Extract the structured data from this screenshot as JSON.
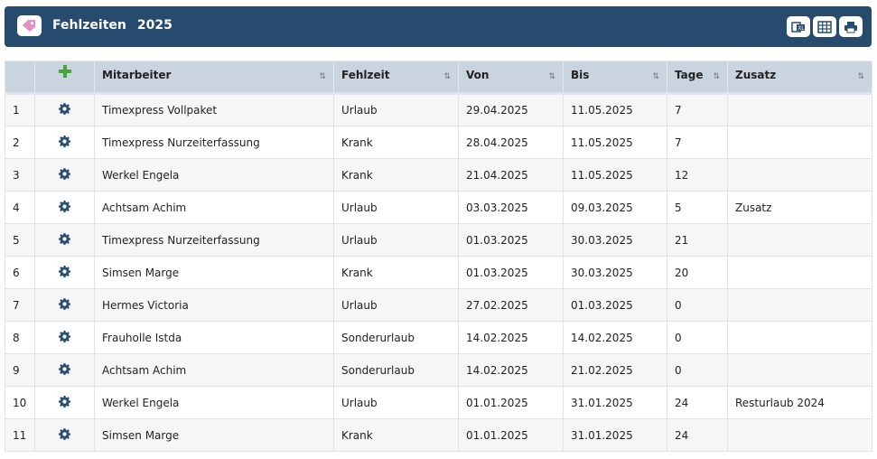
{
  "header": {
    "title": "Fehlzeiten",
    "year": "2025",
    "buttons": [
      "excel-export",
      "table-view",
      "print"
    ]
  },
  "colors": {
    "header_bg": "#274b6e",
    "plus": "#4aa33a",
    "gear": "#2c4f72",
    "tag": "#e48ec2"
  },
  "table": {
    "columns": [
      "",
      "",
      "Mitarbeiter",
      "Fehlzeit",
      "Von",
      "Bis",
      "Tage",
      "Zusatz"
    ],
    "sort_icon": "⇅",
    "rows": [
      {
        "nr": "1",
        "mitarbeiter": "Timexpress Vollpaket",
        "fehlzeit": "Urlaub",
        "von": "29.04.2025",
        "bis": "11.05.2025",
        "tage": "7",
        "zusatz": ""
      },
      {
        "nr": "2",
        "mitarbeiter": "Timexpress Nurzeiterfassung",
        "fehlzeit": "Krank",
        "von": "28.04.2025",
        "bis": "11.05.2025",
        "tage": "7",
        "zusatz": ""
      },
      {
        "nr": "3",
        "mitarbeiter": "Werkel Engela",
        "fehlzeit": "Krank",
        "von": "21.04.2025",
        "bis": "11.05.2025",
        "tage": "12",
        "zusatz": ""
      },
      {
        "nr": "4",
        "mitarbeiter": "Achtsam Achim",
        "fehlzeit": "Urlaub",
        "von": "03.03.2025",
        "bis": "09.03.2025",
        "tage": "5",
        "zusatz": "Zusatz"
      },
      {
        "nr": "5",
        "mitarbeiter": "Timexpress Nurzeiterfassung",
        "fehlzeit": "Urlaub",
        "von": "01.03.2025",
        "bis": "30.03.2025",
        "tage": "21",
        "zusatz": ""
      },
      {
        "nr": "6",
        "mitarbeiter": "Simsen Marge",
        "fehlzeit": "Krank",
        "von": "01.03.2025",
        "bis": "30.03.2025",
        "tage": "20",
        "zusatz": ""
      },
      {
        "nr": "7",
        "mitarbeiter": "Hermes Victoria",
        "fehlzeit": "Urlaub",
        "von": "27.02.2025",
        "bis": "01.03.2025",
        "tage": "0",
        "zusatz": ""
      },
      {
        "nr": "8",
        "mitarbeiter": "Frauholle Istda",
        "fehlzeit": "Sonderurlaub",
        "von": "14.02.2025",
        "bis": "14.02.2025",
        "tage": "0",
        "zusatz": ""
      },
      {
        "nr": "9",
        "mitarbeiter": "Achtsam Achim",
        "fehlzeit": "Sonderurlaub",
        "von": "14.02.2025",
        "bis": "21.02.2025",
        "tage": "0",
        "zusatz": ""
      },
      {
        "nr": "10",
        "mitarbeiter": "Werkel Engela",
        "fehlzeit": "Urlaub",
        "von": "01.01.2025",
        "bis": "31.01.2025",
        "tage": "24",
        "zusatz": "Resturlaub 2024"
      },
      {
        "nr": "11",
        "mitarbeiter": "Simsen Marge",
        "fehlzeit": "Krank",
        "von": "01.01.2025",
        "bis": "31.01.2025",
        "tage": "24",
        "zusatz": ""
      }
    ]
  }
}
